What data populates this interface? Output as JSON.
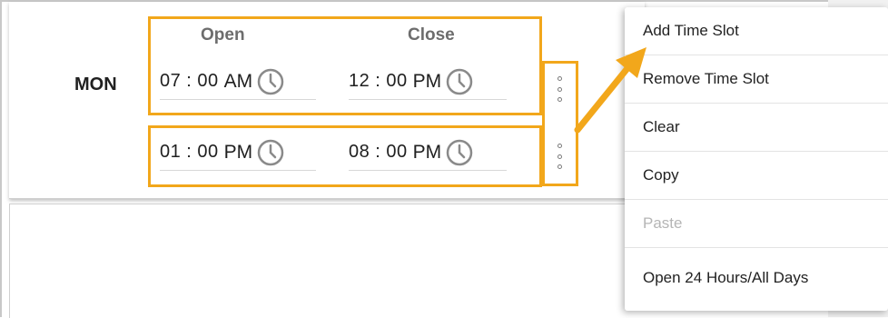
{
  "schedule": {
    "day": "MON",
    "columns": {
      "open": "Open",
      "close": "Close"
    },
    "slots": [
      {
        "open_time": "07 : 00",
        "open_ampm": "AM",
        "close_time": "12 : 00",
        "close_ampm": "PM"
      },
      {
        "open_time": "01 : 00",
        "open_ampm": "PM",
        "close_time": "08 : 00",
        "close_ampm": "PM"
      }
    ]
  },
  "context_menu": {
    "items": [
      {
        "label": "Add Time Slot",
        "enabled": true
      },
      {
        "label": "Remove Time Slot",
        "enabled": true
      },
      {
        "label": "Clear",
        "enabled": true
      },
      {
        "label": "Copy",
        "enabled": true
      },
      {
        "label": "Paste",
        "enabled": false
      },
      {
        "label": "Open 24 Hours/All Days",
        "enabled": true
      }
    ]
  },
  "colors": {
    "highlight": "#f2a71b",
    "icon": "#8a8a8a",
    "disabled_text": "#b5b5b5"
  },
  "icons": [
    "clock-icon",
    "more-vertical-icon",
    "arrow-pointer"
  ]
}
